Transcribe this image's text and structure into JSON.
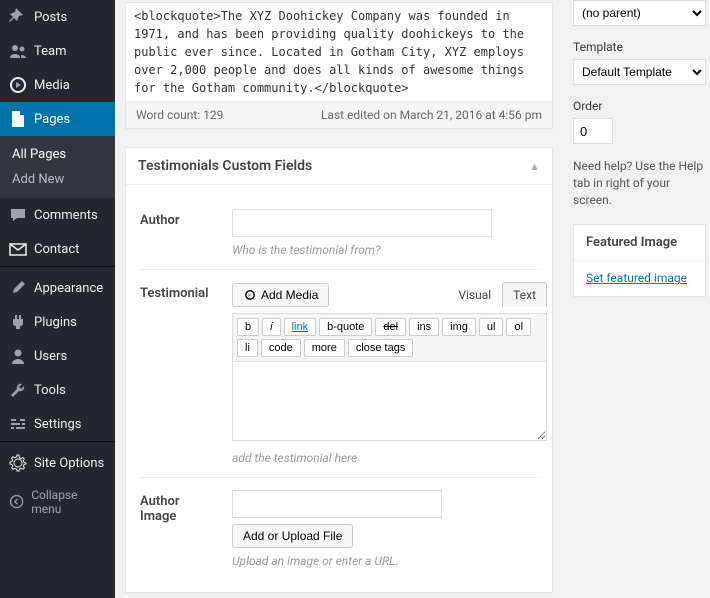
{
  "sidebar": {
    "items": [
      {
        "label": "Posts",
        "icon": "pin"
      },
      {
        "label": "Team",
        "icon": "users"
      },
      {
        "label": "Media",
        "icon": "media"
      },
      {
        "label": "Pages",
        "icon": "page",
        "active": true
      },
      {
        "label": "Comments",
        "icon": "comment"
      },
      {
        "label": "Contact",
        "icon": "mail"
      },
      {
        "label": "Appearance",
        "icon": "brush"
      },
      {
        "label": "Plugins",
        "icon": "plug"
      },
      {
        "label": "Users",
        "icon": "user"
      },
      {
        "label": "Tools",
        "icon": "wrench"
      },
      {
        "label": "Settings",
        "icon": "sliders"
      },
      {
        "label": "Site Options",
        "icon": "gear"
      }
    ],
    "sub_all": "All Pages",
    "sub_add": "Add New",
    "collapse": "Collapse menu"
  },
  "editor": {
    "content": "<blockquote>The XYZ Doohickey Company was founded in 1971, and has been providing quality doohickeys to the public ever since. Located in Gotham City, XYZ employs over 2,000 people and does all kinds of awesome things for the Gotham community.</blockquote>",
    "word_count": "Word count: 129",
    "last_edited": "Last edited on March 21, 2016 at 4:56 pm"
  },
  "metabox": {
    "title": "Testimonials Custom Fields",
    "author": {
      "label": "Author",
      "help": "Who is the testimonial from?"
    },
    "testimonial": {
      "label": "Testimonial",
      "add_media": "Add Media",
      "tab_visual": "Visual",
      "tab_text": "Text",
      "qt": [
        "b",
        "i",
        "link",
        "b-quote",
        "del",
        "ins",
        "img",
        "ul",
        "ol",
        "li",
        "code",
        "more",
        "close tags"
      ],
      "help": "add the testimonial here"
    },
    "author_image": {
      "label": "Author Image",
      "button": "Add or Upload File",
      "help": "Upload an image or enter a URL."
    }
  },
  "rpanel": {
    "parent_value": "(no parent)",
    "template_label": "Template",
    "template_value": "Default Template",
    "order_label": "Order",
    "order_value": "0",
    "help_text": "Need help? Use the Help tab in right of your screen.",
    "featured_title": "Featured Image",
    "featured_link": "Set featured image"
  }
}
